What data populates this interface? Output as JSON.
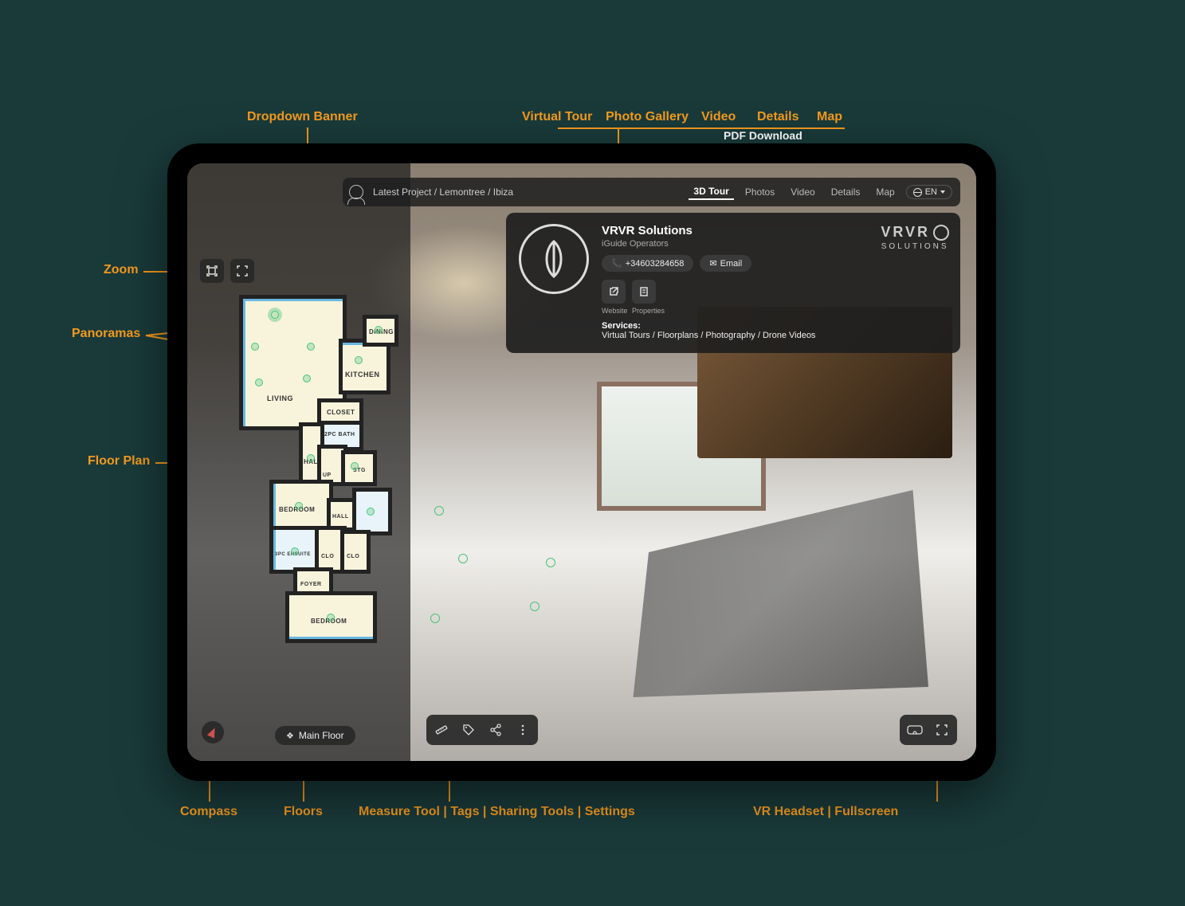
{
  "topbar": {
    "breadcrumb": "Latest Project / Lemontree / Ibiza",
    "tabs": {
      "tour": "3D Tour",
      "photos": "Photos",
      "video": "Video",
      "details": "Details",
      "map": "Map"
    },
    "lang": "EN"
  },
  "banner": {
    "title": "VRVR Solutions",
    "subtitle": "iGuide Operators",
    "phone": "+34603284658",
    "email": "Email",
    "website_label": "Website",
    "properties_label": "Properties",
    "services_label": "Services:",
    "services_text": "Virtual Tours / Floorplans / Photography / Drone Videos",
    "brand_top": "VRVR",
    "brand_bottom": "SOLUTIONS"
  },
  "floorplan": {
    "rooms": {
      "living": "LIVING",
      "kitchen": "KITCHEN",
      "dining": "DINING",
      "closet": "CLOSET",
      "bath1": "2PC BATH",
      "hall1": "HALL",
      "stg": "STG",
      "up": "UP",
      "bedroom1": "BEDROOM",
      "hall2": "HALL",
      "clo1": "CLO",
      "ensuite": "3PC ENSUITE",
      "clo2": "CLO",
      "foyer": "FOYER",
      "bedroom2": "BEDROOM"
    }
  },
  "floor_selector": "Main Floor",
  "annotations": {
    "dropdown_banner": "Dropdown Banner",
    "virtual_tour": "Virtual Tour",
    "photo_gallery": "Photo Gallery",
    "video": "Video",
    "details": "Details",
    "map": "Map",
    "pdf_download": "PDF Download",
    "zoom": "Zoom",
    "panoramas": "Panoramas",
    "floor_plan": "Floor Plan",
    "compass": "Compass",
    "floors": "Floors",
    "bottom_tools": "Measure Tool | Tags | Sharing Tools | Settings",
    "vr_fullscreen": "VR Headset | Fullscreen"
  }
}
